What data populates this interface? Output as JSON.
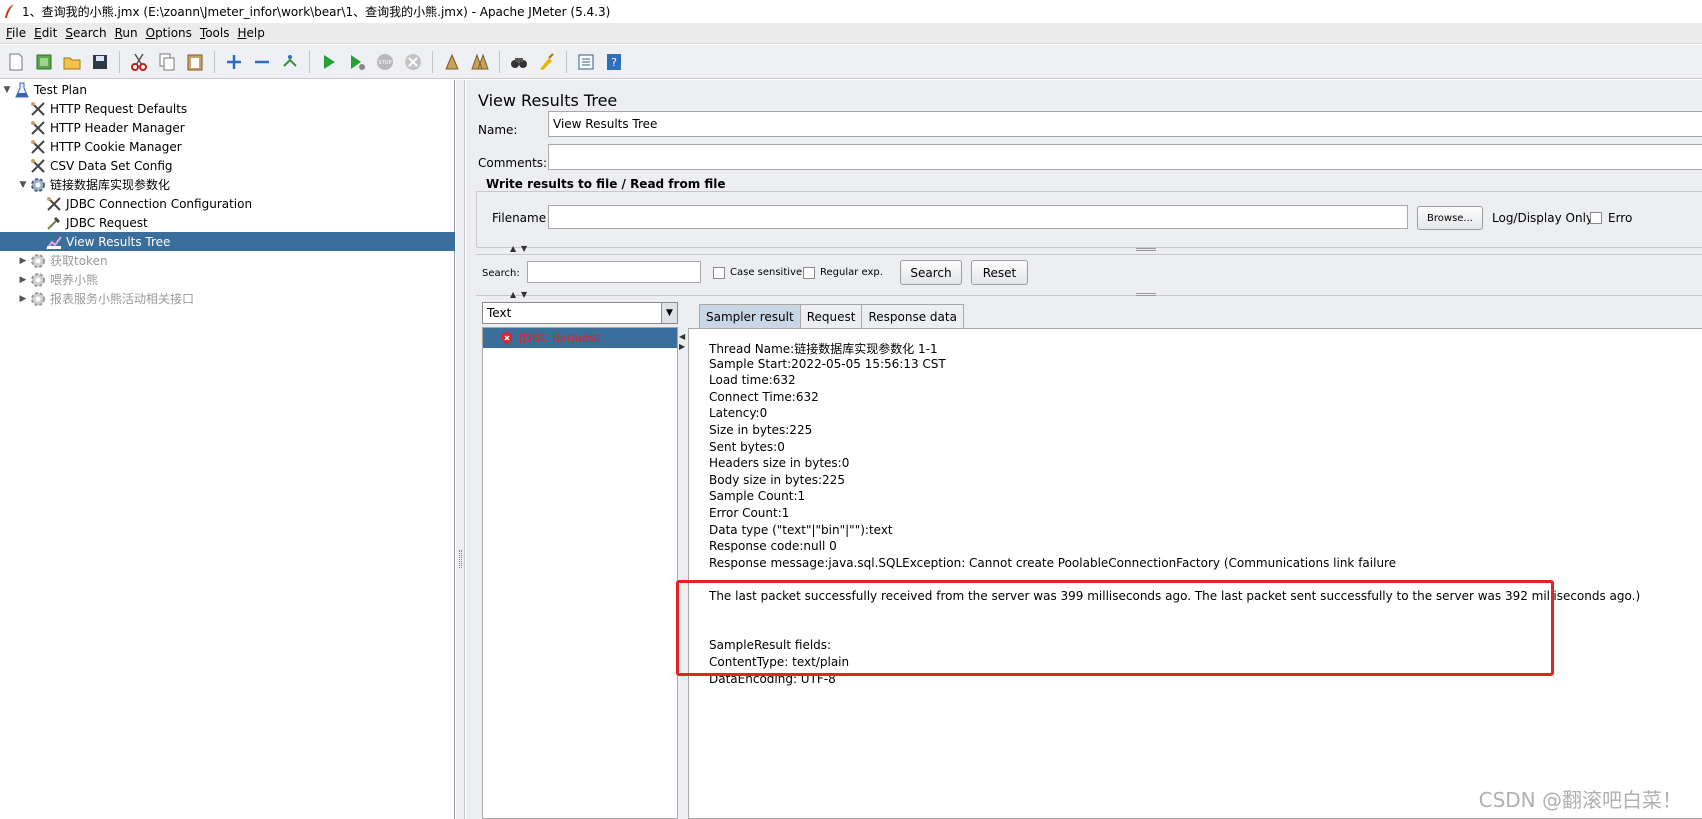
{
  "window": {
    "title": "1、查询我的小熊.jmx (E:\\zoann\\Jmeter_infor\\work\\bear\\1、查询我的小熊.jmx) - Apache JMeter (5.4.3)"
  },
  "menu": [
    {
      "key": "F",
      "rest": "ile"
    },
    {
      "key": "E",
      "rest": "dit"
    },
    {
      "key": "S",
      "rest": "earch"
    },
    {
      "key": "R",
      "rest": "un"
    },
    {
      "key": "O",
      "rest": "ptions"
    },
    {
      "key": "T",
      "rest": "ools"
    },
    {
      "key": "H",
      "rest": "elp"
    }
  ],
  "toolbar_icons": [
    "new-icon",
    "templates-icon",
    "open-icon",
    "save-icon",
    "cut-icon",
    "copy-icon",
    "paste-icon",
    "expand-icon",
    "collapse-icon",
    "toggle-icon",
    "start-icon",
    "start-no-pause-icon",
    "stop-icon",
    "shutdown-icon",
    "clear-icon",
    "clear-all-icon",
    "search-icon",
    "reset-search-icon",
    "function-helper-icon",
    "help-icon"
  ],
  "tree": [
    {
      "label": "Test Plan"
    },
    {
      "label": "HTTP Request Defaults"
    },
    {
      "label": "HTTP Header Manager"
    },
    {
      "label": "HTTP Cookie Manager"
    },
    {
      "label": "CSV Data Set Config"
    },
    {
      "label": "链接数据库实现参数化"
    },
    {
      "label": "JDBC Connection Configuration"
    },
    {
      "label": "JDBC Request"
    },
    {
      "label": "View Results Tree"
    },
    {
      "label": "获取token"
    },
    {
      "label": "喂养小熊"
    },
    {
      "label": "报表服务小熊活动相关接口"
    }
  ],
  "panel": {
    "title": "View Results Tree",
    "name_label": "Name:",
    "name_value": "View Results Tree",
    "comments_label": "Comments:",
    "comments_value": "",
    "write_title": "Write results to file / Read from file",
    "filename_label": "Filename",
    "filename_value": "",
    "browse_label": "Browse...",
    "log_display_label": "Log/Display Only:",
    "errors_label": "Erro",
    "search_label": "Search:",
    "search_value": "",
    "case_sensitive_label": "Case sensitive",
    "regular_exp_label": "Regular exp.",
    "search_button": "Search",
    "reset_button": "Reset",
    "renderer_value": "Text",
    "result_item": "JDBC Request"
  },
  "tabs": [
    "Sampler result",
    "Request",
    "Response data"
  ],
  "sampler_lines": [
    "Thread Name:链接数据库实现参数化 1-1",
    "Sample Start:2022-05-05 15:56:13 CST",
    "Load time:632",
    "Connect Time:632",
    "Latency:0",
    "Size in bytes:225",
    "Sent bytes:0",
    "Headers size in bytes:0",
    "Body size in bytes:225",
    "Sample Count:1",
    "Error Count:1",
    "Data type (\"text\"|\"bin\"|\"\"):text",
    "Response code:null 0",
    "Response message:java.sql.SQLException: Cannot create PoolableConnectionFactory (Communications link failure",
    "",
    "The last packet successfully received from the server was 399 milliseconds ago.  The last packet sent successfully to the server was 392 milliseconds ago.)",
    "",
    "",
    "SampleResult fields:",
    "ContentType: text/plain",
    "DataEncoding: UTF-8"
  ],
  "watermark": "CSDN @翻滚吧白菜！",
  "colors": {
    "selection": "#3a6e9b",
    "highlight_box": "#e8231e",
    "error_text": "#e0241f"
  }
}
